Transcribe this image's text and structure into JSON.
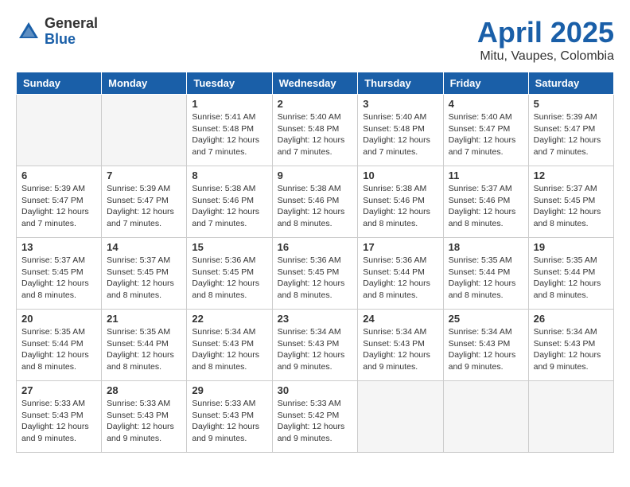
{
  "header": {
    "logo_general": "General",
    "logo_blue": "Blue",
    "month_title": "April 2025",
    "location": "Mitu, Vaupes, Colombia"
  },
  "days_of_week": [
    "Sunday",
    "Monday",
    "Tuesday",
    "Wednesday",
    "Thursday",
    "Friday",
    "Saturday"
  ],
  "weeks": [
    [
      {
        "day": "",
        "info": ""
      },
      {
        "day": "",
        "info": ""
      },
      {
        "day": "1",
        "info": "Sunrise: 5:41 AM\nSunset: 5:48 PM\nDaylight: 12 hours and 7 minutes."
      },
      {
        "day": "2",
        "info": "Sunrise: 5:40 AM\nSunset: 5:48 PM\nDaylight: 12 hours and 7 minutes."
      },
      {
        "day": "3",
        "info": "Sunrise: 5:40 AM\nSunset: 5:48 PM\nDaylight: 12 hours and 7 minutes."
      },
      {
        "day": "4",
        "info": "Sunrise: 5:40 AM\nSunset: 5:47 PM\nDaylight: 12 hours and 7 minutes."
      },
      {
        "day": "5",
        "info": "Sunrise: 5:39 AM\nSunset: 5:47 PM\nDaylight: 12 hours and 7 minutes."
      }
    ],
    [
      {
        "day": "6",
        "info": "Sunrise: 5:39 AM\nSunset: 5:47 PM\nDaylight: 12 hours and 7 minutes."
      },
      {
        "day": "7",
        "info": "Sunrise: 5:39 AM\nSunset: 5:47 PM\nDaylight: 12 hours and 7 minutes."
      },
      {
        "day": "8",
        "info": "Sunrise: 5:38 AM\nSunset: 5:46 PM\nDaylight: 12 hours and 7 minutes."
      },
      {
        "day": "9",
        "info": "Sunrise: 5:38 AM\nSunset: 5:46 PM\nDaylight: 12 hours and 8 minutes."
      },
      {
        "day": "10",
        "info": "Sunrise: 5:38 AM\nSunset: 5:46 PM\nDaylight: 12 hours and 8 minutes."
      },
      {
        "day": "11",
        "info": "Sunrise: 5:37 AM\nSunset: 5:46 PM\nDaylight: 12 hours and 8 minutes."
      },
      {
        "day": "12",
        "info": "Sunrise: 5:37 AM\nSunset: 5:45 PM\nDaylight: 12 hours and 8 minutes."
      }
    ],
    [
      {
        "day": "13",
        "info": "Sunrise: 5:37 AM\nSunset: 5:45 PM\nDaylight: 12 hours and 8 minutes."
      },
      {
        "day": "14",
        "info": "Sunrise: 5:37 AM\nSunset: 5:45 PM\nDaylight: 12 hours and 8 minutes."
      },
      {
        "day": "15",
        "info": "Sunrise: 5:36 AM\nSunset: 5:45 PM\nDaylight: 12 hours and 8 minutes."
      },
      {
        "day": "16",
        "info": "Sunrise: 5:36 AM\nSunset: 5:45 PM\nDaylight: 12 hours and 8 minutes."
      },
      {
        "day": "17",
        "info": "Sunrise: 5:36 AM\nSunset: 5:44 PM\nDaylight: 12 hours and 8 minutes."
      },
      {
        "day": "18",
        "info": "Sunrise: 5:35 AM\nSunset: 5:44 PM\nDaylight: 12 hours and 8 minutes."
      },
      {
        "day": "19",
        "info": "Sunrise: 5:35 AM\nSunset: 5:44 PM\nDaylight: 12 hours and 8 minutes."
      }
    ],
    [
      {
        "day": "20",
        "info": "Sunrise: 5:35 AM\nSunset: 5:44 PM\nDaylight: 12 hours and 8 minutes."
      },
      {
        "day": "21",
        "info": "Sunrise: 5:35 AM\nSunset: 5:44 PM\nDaylight: 12 hours and 8 minutes."
      },
      {
        "day": "22",
        "info": "Sunrise: 5:34 AM\nSunset: 5:43 PM\nDaylight: 12 hours and 8 minutes."
      },
      {
        "day": "23",
        "info": "Sunrise: 5:34 AM\nSunset: 5:43 PM\nDaylight: 12 hours and 9 minutes."
      },
      {
        "day": "24",
        "info": "Sunrise: 5:34 AM\nSunset: 5:43 PM\nDaylight: 12 hours and 9 minutes."
      },
      {
        "day": "25",
        "info": "Sunrise: 5:34 AM\nSunset: 5:43 PM\nDaylight: 12 hours and 9 minutes."
      },
      {
        "day": "26",
        "info": "Sunrise: 5:34 AM\nSunset: 5:43 PM\nDaylight: 12 hours and 9 minutes."
      }
    ],
    [
      {
        "day": "27",
        "info": "Sunrise: 5:33 AM\nSunset: 5:43 PM\nDaylight: 12 hours and 9 minutes."
      },
      {
        "day": "28",
        "info": "Sunrise: 5:33 AM\nSunset: 5:43 PM\nDaylight: 12 hours and 9 minutes."
      },
      {
        "day": "29",
        "info": "Sunrise: 5:33 AM\nSunset: 5:43 PM\nDaylight: 12 hours and 9 minutes."
      },
      {
        "day": "30",
        "info": "Sunrise: 5:33 AM\nSunset: 5:42 PM\nDaylight: 12 hours and 9 minutes."
      },
      {
        "day": "",
        "info": ""
      },
      {
        "day": "",
        "info": ""
      },
      {
        "day": "",
        "info": ""
      }
    ]
  ]
}
